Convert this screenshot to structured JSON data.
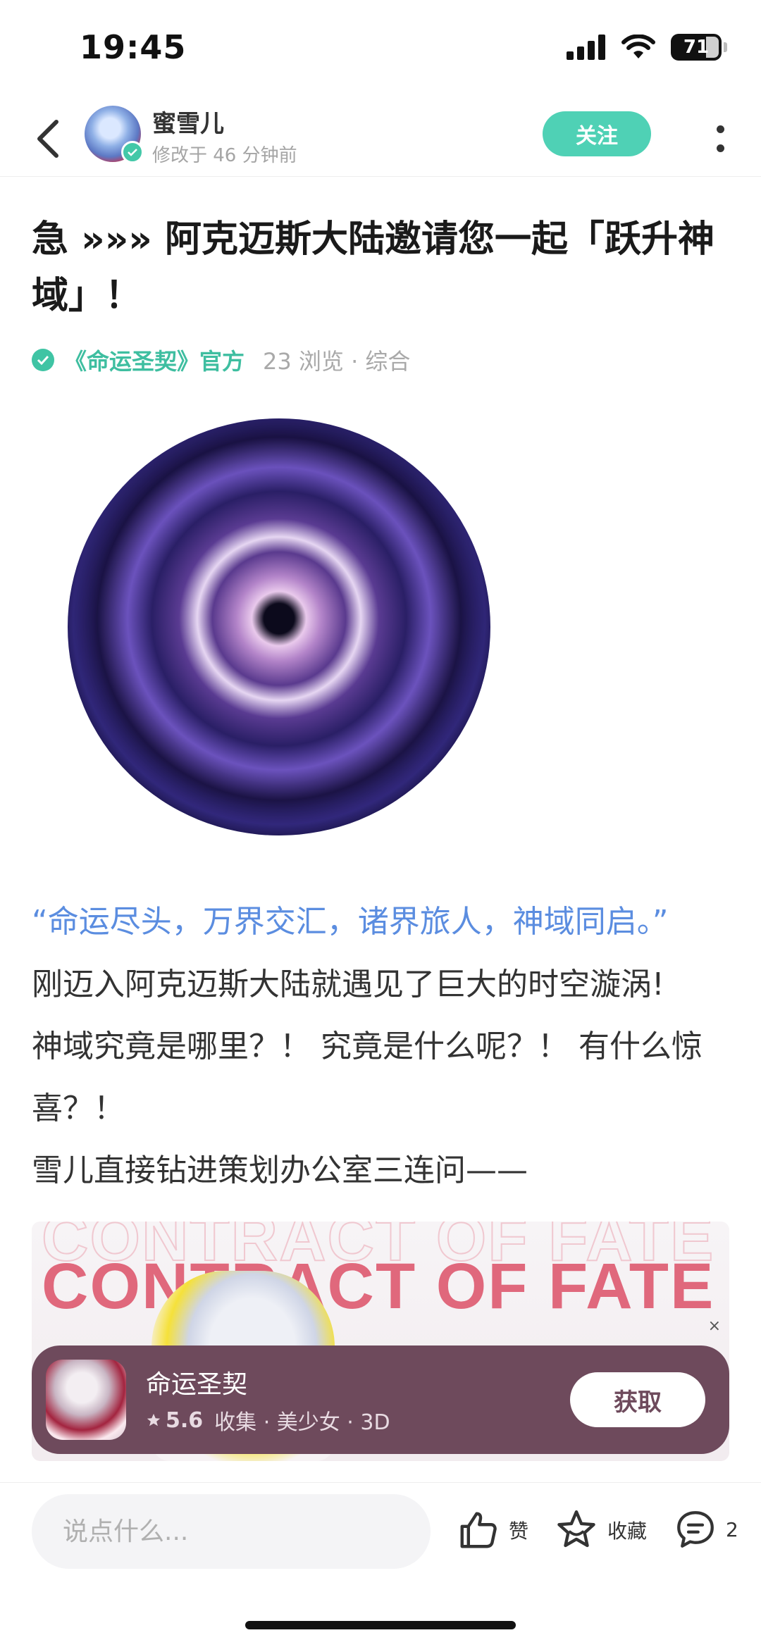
{
  "status_bar": {
    "time": "19:45",
    "battery": "71"
  },
  "header": {
    "username": "蜜雪儿",
    "edit_time": "修改于 46 分钟前",
    "follow_label": "关注"
  },
  "post": {
    "title": "急 »»» 阿克迈斯大陆邀请您一起「跃升神域」！",
    "official": "《命运圣契》官方",
    "stats": "23 浏览 · 综合",
    "quote": "“命运尽头，万界交汇，诸界旅人，神域同启。”",
    "paragraphs": [
      "刚迈入阿克迈斯大陆就遇见了巨大的时空漩涡!",
      "神域究竟是哪里？！ 究竟是什么呢？！ 有什么惊喜？！",
      "雪儿直接钻进策划办公室三连问——"
    ],
    "banner_text": "CONTRACT OF FATE"
  },
  "app_card": {
    "name": "命运圣契",
    "score": "5.6",
    "tags": "收集 · 美少女 · 3D",
    "get_label": "获取",
    "close_glyph": "×"
  },
  "bottom_bar": {
    "comment_placeholder": "说点什么...",
    "like_label": "赞",
    "fav_label": "收藏",
    "comment_count": "2"
  },
  "colors": {
    "accent": "#4fd1b5",
    "quote_blue": "#5b8de0",
    "card_bg": "#6e4a5c",
    "banner_red": "#e0687c"
  },
  "icons": [
    "back-arrow-icon",
    "verified-icon",
    "more-icon",
    "star-icon",
    "thumbs-up-icon",
    "star-outline-icon",
    "comment-icon",
    "signal-icon",
    "wifi-icon",
    "battery-icon"
  ]
}
